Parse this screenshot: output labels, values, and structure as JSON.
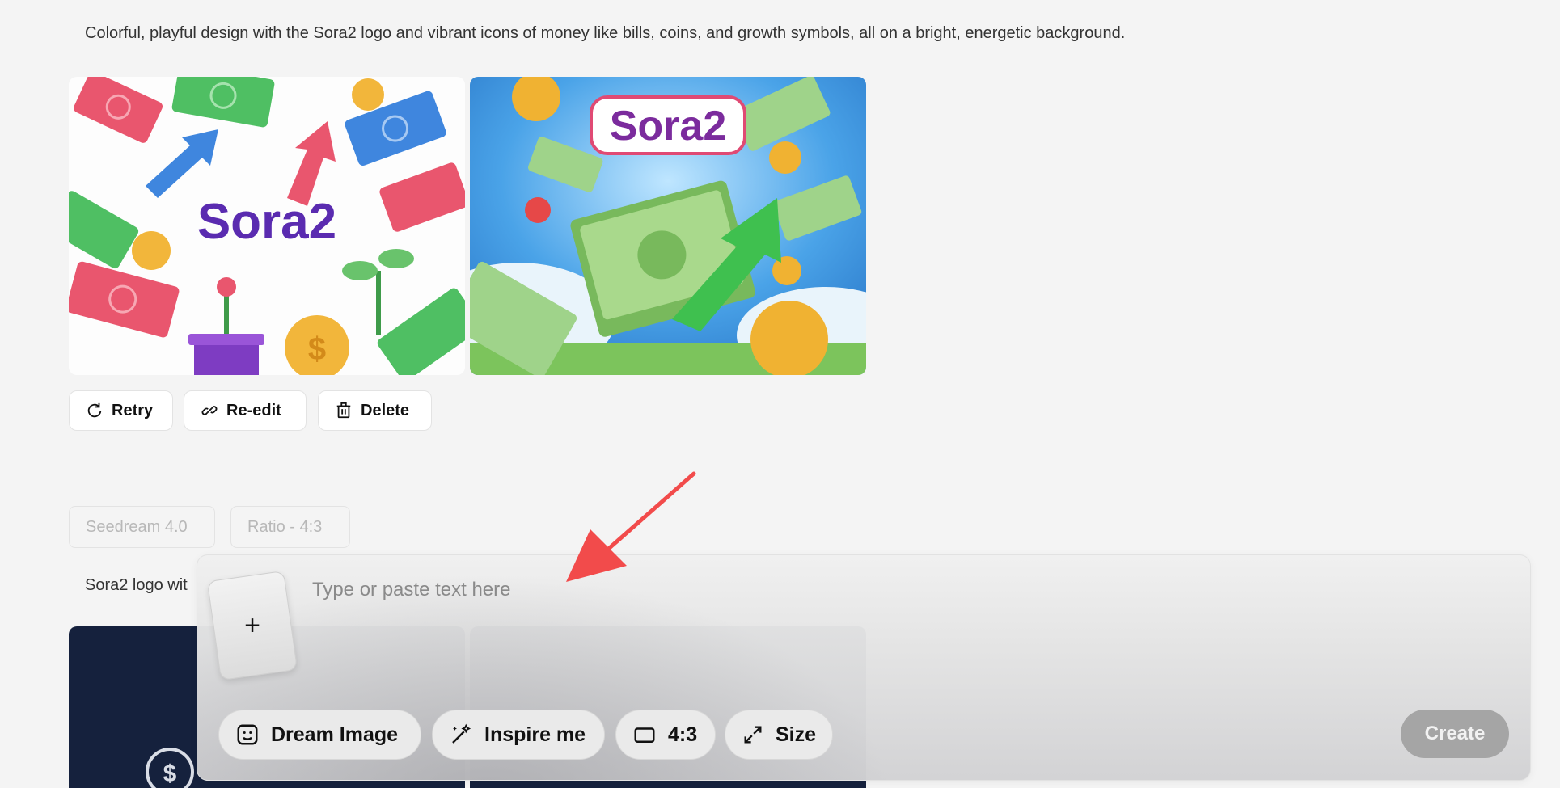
{
  "prompt1": "Colorful, playful design with the Sora2 logo and vibrant icons of money like bills, coins, and growth symbols, all on a bright, energetic background.",
  "images": [
    {
      "logo_text": "Sora2"
    },
    {
      "logo_text": "Sora2"
    }
  ],
  "actions": {
    "retry": "Retry",
    "reedit": "Re-edit",
    "delete": "Delete"
  },
  "tags": {
    "model": "Seedream 4.0",
    "ratio": "Ratio - 4:3"
  },
  "prompt2": "Sora2 logo wit",
  "composer": {
    "placeholder": "Type or paste text here",
    "attach": "+",
    "dream": "Dream Image",
    "inspire": "Inspire me",
    "ratio": "4:3",
    "size": "Size",
    "create": "Create"
  },
  "colors": {
    "annotation_arrow": "#f24b4b",
    "create_disabled": "#a5a5a5"
  }
}
